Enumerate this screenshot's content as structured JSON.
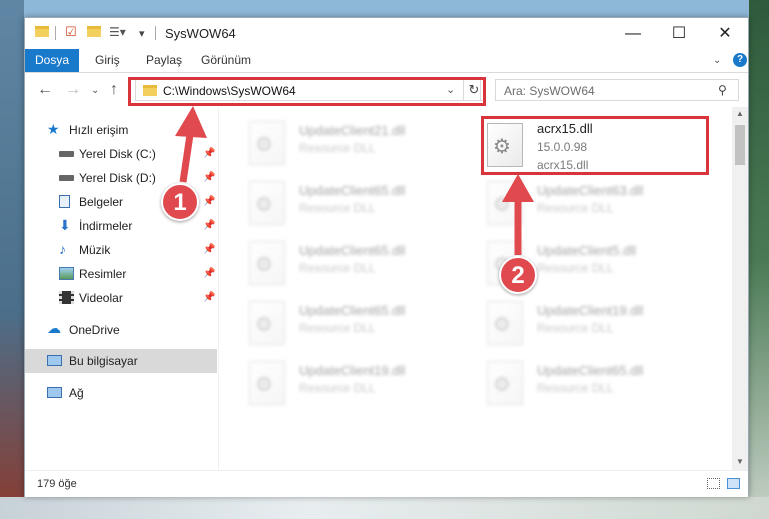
{
  "window": {
    "title": "SysWOW64"
  },
  "ribbon": {
    "tabs": [
      "Dosya",
      "Giriş",
      "Paylaş",
      "Görünüm"
    ]
  },
  "address": {
    "path": "C:\\Windows\\SysWOW64"
  },
  "search": {
    "placeholder": "Ara: SysWOW64"
  },
  "sidebar": {
    "items": [
      {
        "label": "Hızlı erişim"
      },
      {
        "label": "Yerel Disk (C:)"
      },
      {
        "label": "Yerel Disk (D:)"
      },
      {
        "label": "Belgeler"
      },
      {
        "label": "İndirmeler"
      },
      {
        "label": "Müzik"
      },
      {
        "label": "Resimler"
      },
      {
        "label": "Videolar"
      },
      {
        "label": "OneDrive"
      },
      {
        "label": "Bu bilgisayar"
      },
      {
        "label": "Ağ"
      }
    ]
  },
  "files": [
    {
      "name": "UpdateClient21.dll",
      "desc": "Resource DLL"
    },
    {
      "name": "acrx15.dll",
      "version": "15.0.0.98",
      "desc": "acrx15.dll"
    },
    {
      "name": "UpdateClient65.dll",
      "desc": "Resource DLL"
    },
    {
      "name": "UpdateClient63.dll",
      "desc": "Resource DLL"
    },
    {
      "name": "UpdateClient65.dll",
      "desc": "Resource DLL"
    },
    {
      "name": "UpdateClient5.dll",
      "desc": "Resource DLL"
    },
    {
      "name": "UpdateClient65.dll",
      "desc": "Resource DLL"
    },
    {
      "name": "UpdateClient19.dll",
      "desc": "Resource DLL"
    },
    {
      "name": "UpdateClient19.dll",
      "desc": "Resource DLL"
    },
    {
      "name": "UpdateClient65.dll",
      "desc": "Resource DLL"
    }
  ],
  "status": {
    "count": "179 öğe"
  },
  "annotations": {
    "badge1": "1",
    "badge2": "2"
  },
  "colors": {
    "accent": "#1979ca",
    "highlight": "#d9343a"
  }
}
